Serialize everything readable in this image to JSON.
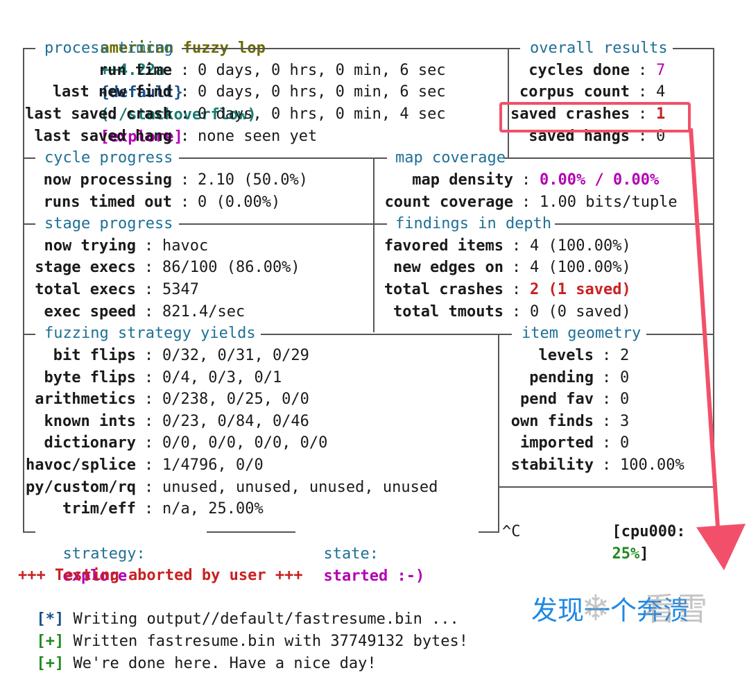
{
  "header": {
    "app": "american fuzzy lop",
    "version": "++4.22a",
    "banner": "{default}",
    "target": "(./stackoverflow)",
    "mode": "[explore]"
  },
  "process_timing": {
    "title": "process timing",
    "run_time_label": "run time",
    "run_time": "0 days, 0 hrs, 0 min, 6 sec",
    "last_find_label": "last new find",
    "last_find": "0 days, 0 hrs, 0 min, 6 sec",
    "last_crash_label": "last saved crash",
    "last_crash": "0 days, 0 hrs, 0 min, 4 sec",
    "last_hang_label": "last saved hang",
    "last_hang": "none seen yet"
  },
  "overall_results": {
    "title": "overall results",
    "cycles_label": "cycles done",
    "cycles": "7",
    "corpus_label": "corpus count",
    "corpus": "4",
    "crashes_label": "saved crashes",
    "crashes": "1",
    "hangs_label": "saved hangs",
    "hangs": "0"
  },
  "cycle_progress": {
    "title": "cycle progress",
    "now_label": "now processing",
    "now": "2.10 (50.0%)",
    "timed_label": "runs timed out",
    "timed": "0 (0.00%)"
  },
  "map_coverage": {
    "title": "map coverage",
    "density_label": "map density",
    "density": "0.00% / 0.00%",
    "count_label": "count coverage",
    "count": "1.00 bits/tuple"
  },
  "stage_progress": {
    "title": "stage progress",
    "trying_label": "now trying",
    "trying": "havoc",
    "execs_label": "stage execs",
    "execs": "86/100 (86.00%)",
    "total_label": "total execs",
    "total": "5347",
    "speed_label": "exec speed",
    "speed": "821.4/sec"
  },
  "findings": {
    "title": "findings in depth",
    "favored_label": "favored items",
    "favored": "4 (100.00%)",
    "edges_label": "new edges on",
    "edges": "4 (100.00%)",
    "crashes_label": "total crashes",
    "crashes": "2 (1 saved)",
    "tmouts_label": "total tmouts",
    "tmouts": "0 (0 saved)"
  },
  "strategy_yields": {
    "title": "fuzzing strategy yields",
    "rows": [
      {
        "label": "bit flips",
        "value": "0/32, 0/31, 0/29"
      },
      {
        "label": "byte flips",
        "value": "0/4, 0/3, 0/1"
      },
      {
        "label": "arithmetics",
        "value": "0/238, 0/25, 0/0"
      },
      {
        "label": "known ints",
        "value": "0/23, 0/84, 0/46"
      },
      {
        "label": "dictionary",
        "value": "0/0, 0/0, 0/0, 0/0"
      },
      {
        "label": "havoc/splice",
        "value": "1/4796, 0/0"
      },
      {
        "label": "py/custom/rq",
        "value": "unused, unused, unused, unused"
      },
      {
        "label": "trim/eff",
        "value": "n/a, 25.00%"
      }
    ]
  },
  "item_geometry": {
    "title": "item geometry",
    "rows": [
      {
        "label": "levels",
        "value": "2"
      },
      {
        "label": "pending",
        "value": "0"
      },
      {
        "label": "pend fav",
        "value": "0"
      },
      {
        "label": "own finds",
        "value": "3"
      },
      {
        "label": "imported",
        "value": "0"
      },
      {
        "label": "stability",
        "value": "100.00%"
      }
    ]
  },
  "cpu": {
    "prefix": "[cpu000:",
    "value": "25%",
    "suffix": "]"
  },
  "footer": {
    "strategy_label": "strategy:",
    "strategy": "explore",
    "state_label": "state:",
    "state": "started :-)",
    "ctrl": "^C"
  },
  "log": {
    "abort": "+++ Testing aborted by user +++",
    "line1_tag": "[*]",
    "line1": "Writing output//default/fastresume.bin ...",
    "line2_tag": "[+]",
    "line2": "Written fastresume.bin with 37749132 bytes!",
    "line3_tag": "[+]",
    "line3": "We're done here. Have a nice day!"
  },
  "annotation": {
    "text": "发现一个奔溃",
    "watermark": "看雪",
    "color": "#f2506a"
  }
}
